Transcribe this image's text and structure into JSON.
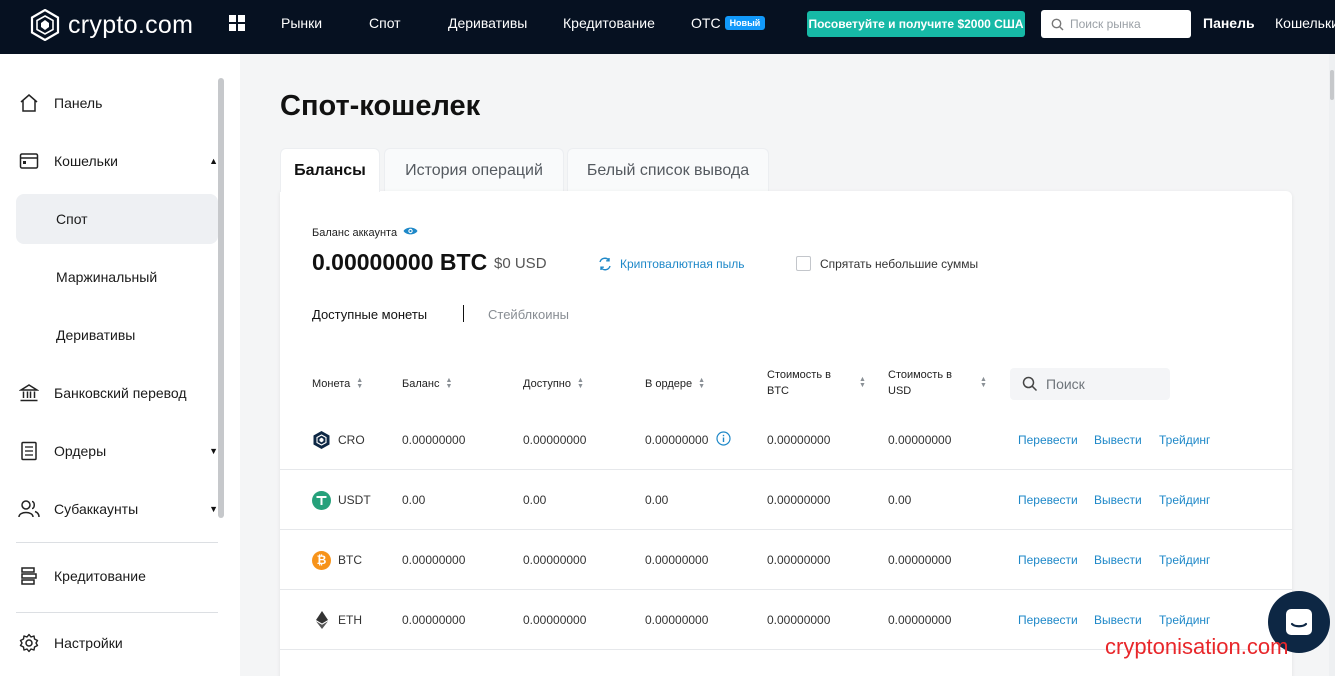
{
  "brand": {
    "name": "crypto.com"
  },
  "topnav": {
    "items": [
      "Рынки",
      "Спот",
      "Деривативы",
      "Кредитование",
      "OTC"
    ],
    "otc_badge": "Новый",
    "promo": "Посоветуйте и получите $2000 США",
    "search_placeholder": "Поиск рынка",
    "dashboard": "Панель",
    "wallet": "Кошельки"
  },
  "sidebar": {
    "items": {
      "dashboard": "Панель",
      "wallets": "Кошельки",
      "spot": "Спот",
      "margin": "Маржинальный",
      "derivatives": "Деривативы",
      "bank": "Банковский перевод",
      "orders": "Ордеры",
      "subaccounts": "Субаккаунты",
      "lending": "Кредитование",
      "settings": "Настройки"
    }
  },
  "main": {
    "title": "Спот-кошелек",
    "tabs": [
      "Балансы",
      "История операций",
      "Белый список вывода"
    ],
    "balance_label": "Баланс аккаунта",
    "balance_btc": "0.00000000 BTC",
    "balance_usd": "$0 USD",
    "crypto_dust": "Криптовалютная пыль",
    "hide_small": "Спрятать небольшие суммы",
    "subtabs": [
      "Доступные монеты",
      "Стейблкоины"
    ],
    "table": {
      "headers": [
        "Монета",
        "Баланс",
        "Доступно",
        "В ордере",
        "Стоимость в BTC",
        "Стоимость в USD"
      ],
      "search_placeholder": "Поиск",
      "actions": [
        "Перевести",
        "Вывести",
        "Трейдинг"
      ],
      "rows": [
        {
          "coin": "CRO",
          "balance": "0.00000000",
          "available": "0.00000000",
          "in_order": "0.00000000",
          "btc_value": "0.00000000",
          "usd_value": "0.00000000"
        },
        {
          "coin": "USDT",
          "balance": "0.00",
          "available": "0.00",
          "in_order": "0.00",
          "btc_value": "0.00000000",
          "usd_value": "0.00"
        },
        {
          "coin": "BTC",
          "balance": "0.00000000",
          "available": "0.00000000",
          "in_order": "0.00000000",
          "btc_value": "0.00000000",
          "usd_value": "0.00000000"
        },
        {
          "coin": "ETH",
          "balance": "0.00000000",
          "available": "0.00000000",
          "in_order": "0.00000000",
          "btc_value": "0.00000000",
          "usd_value": "0.00000000"
        }
      ]
    }
  },
  "watermark": "cryptonisation.com",
  "colors": {
    "nav_bg": "#061121",
    "accent_link": "#1e88c8",
    "promo": "#16b9a6",
    "usdt": "#26a17b",
    "btc": "#f7931a",
    "badge": "#1199fa"
  }
}
